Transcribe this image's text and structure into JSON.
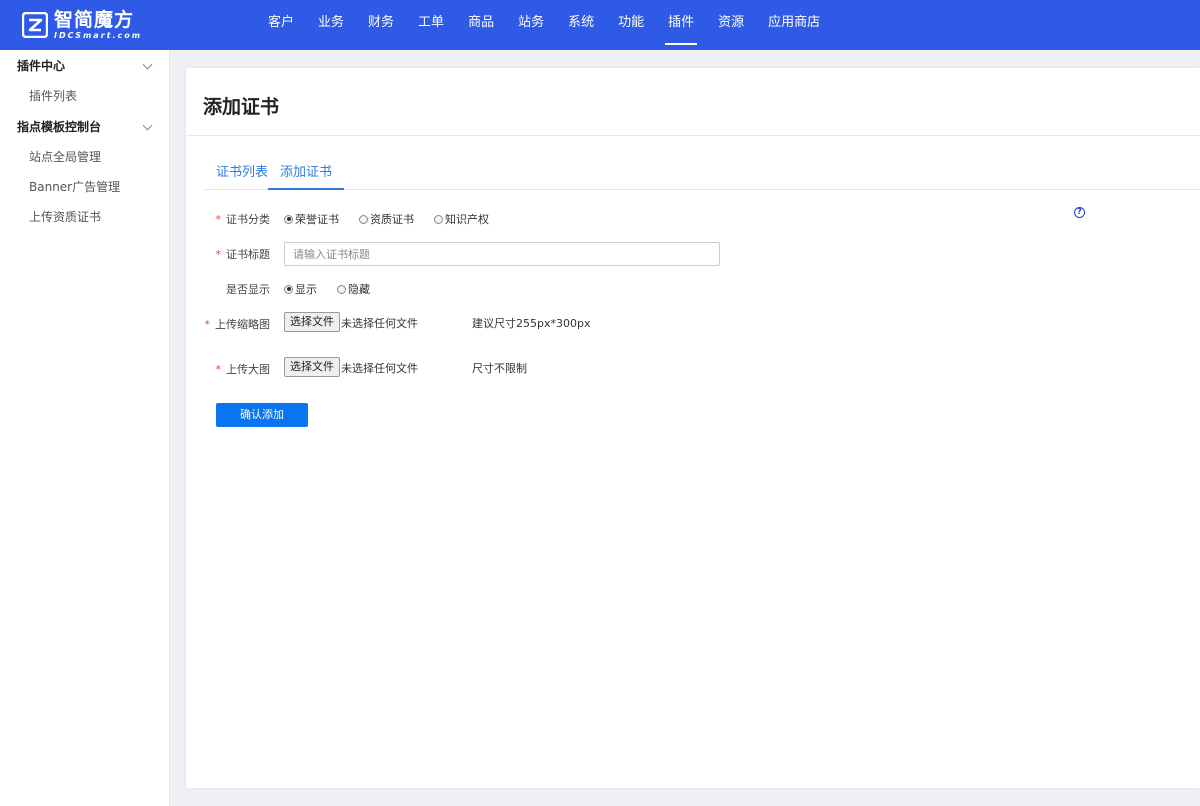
{
  "brand": {
    "name_cn": "智简魔方",
    "name_en": "IDCSmart.com"
  },
  "topnav": {
    "items": [
      {
        "label": "客户"
      },
      {
        "label": "业务"
      },
      {
        "label": "财务"
      },
      {
        "label": "工单"
      },
      {
        "label": "商品"
      },
      {
        "label": "站务"
      },
      {
        "label": "系统"
      },
      {
        "label": "功能"
      },
      {
        "label": "插件",
        "active": true
      },
      {
        "label": "资源"
      },
      {
        "label": "应用商店"
      }
    ]
  },
  "sidebar": {
    "groups": [
      {
        "label": "插件中心",
        "items": [
          {
            "label": "插件列表"
          }
        ]
      },
      {
        "label": "指点模板控制台",
        "items": [
          {
            "label": "站点全局管理"
          },
          {
            "label": "Banner广告管理"
          },
          {
            "label": "上传资质证书"
          }
        ]
      }
    ]
  },
  "page": {
    "title": "添加证书",
    "tabs": [
      {
        "label": "证书列表",
        "active": false
      },
      {
        "label": "添加证书",
        "active": true
      }
    ],
    "help_icon_label": "?"
  },
  "form": {
    "required_mark": "*",
    "category": {
      "label": "证书分类",
      "options": [
        {
          "label": "荣誉证书",
          "checked": true
        },
        {
          "label": "资质证书",
          "checked": false
        },
        {
          "label": "知识产权",
          "checked": false
        }
      ]
    },
    "title": {
      "label": "证书标题",
      "placeholder": "请输入证书标题",
      "value": ""
    },
    "display": {
      "label": "是否显示",
      "options": [
        {
          "label": "显示",
          "checked": true
        },
        {
          "label": "隐藏",
          "checked": false
        }
      ]
    },
    "thumbnail": {
      "label": "上传缩略图",
      "button_label": "选择文件",
      "status": "未选择任何文件",
      "hint": "建议尺寸255px*300px"
    },
    "large_image": {
      "label": "上传大图",
      "button_label": "选择文件",
      "status": "未选择任何文件",
      "hint": "尺寸不限制"
    },
    "submit_label": "确认添加"
  }
}
